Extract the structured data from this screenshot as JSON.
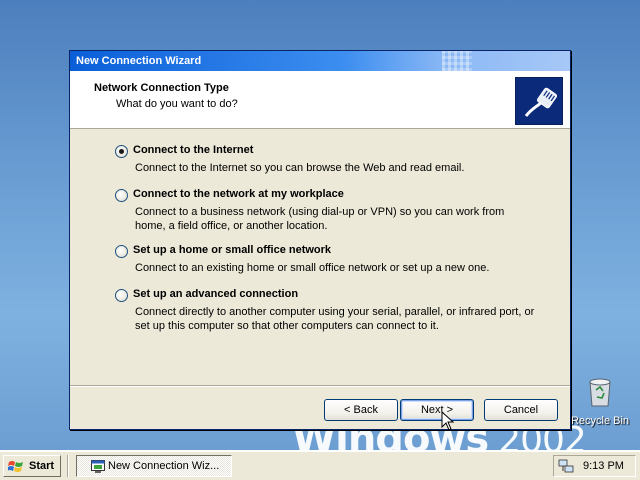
{
  "window": {
    "title": "New Connection Wizard",
    "header_title": "Network Connection Type",
    "header_subtitle": "What do you want to do?",
    "header_icon": "network-cable-icon"
  },
  "options": [
    {
      "label": "Connect to the Internet",
      "description": "Connect to the Internet so you can browse the Web and read email.",
      "selected": true
    },
    {
      "label": "Connect to the network at my workplace",
      "description": "Connect to a business network (using dial-up or VPN) so you can work from home, a field office, or another location.",
      "selected": false
    },
    {
      "label": "Set up a home or small office network",
      "description": "Connect to an existing home or small office network or set up a new one.",
      "selected": false
    },
    {
      "label": "Set up an advanced connection",
      "description": "Connect directly to another computer using your serial, parallel, or infrared port, or set up this computer so that other computers can connect to it.",
      "selected": false
    }
  ],
  "buttons": {
    "back": "< Back",
    "next": "Next >",
    "cancel": "Cancel"
  },
  "desktop": {
    "recycle_bin_label": "Recycle Bin",
    "wallpaper_brand": "Windows",
    "wallpaper_year": "2002"
  },
  "taskbar": {
    "start_label": "Start",
    "task_item_label": "New Connection Wiz...",
    "clock": "9:13 PM"
  },
  "colors": {
    "title_bar": "#0a5fd8",
    "window_bg": "#ece9d8",
    "selected_radio": "#21a121"
  }
}
